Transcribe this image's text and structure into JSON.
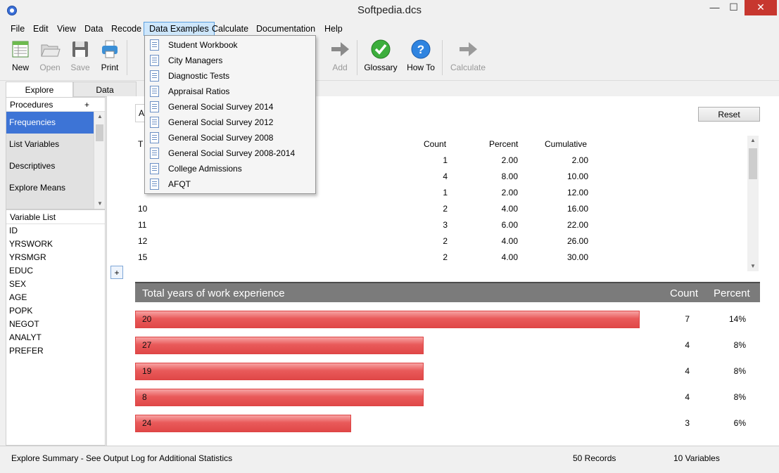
{
  "window": {
    "title": "Softpedia.dcs",
    "min_glyph": "—",
    "max_glyph": "☐",
    "close_glyph": "✕"
  },
  "menu": [
    "File",
    "Edit",
    "View",
    "Data",
    "Recode",
    "Data Examples",
    "Calculate",
    "Documentation",
    "Help"
  ],
  "toolbar": {
    "new": "New",
    "open": "Open",
    "save": "Save",
    "print": "Print",
    "add": "Add",
    "glossary": "Glossary",
    "howto": "How To",
    "calculate": "Calculate"
  },
  "tabs": [
    "Explore",
    "Data"
  ],
  "procedures": {
    "header": "Procedures",
    "plus": "+",
    "items": [
      "Frequencies",
      "List Variables",
      "Descriptives",
      "Explore Means"
    ]
  },
  "variables": {
    "header": "Variable List",
    "items": [
      "ID",
      "YRSWORK",
      "YRSMGR",
      "EDUC",
      "SEX",
      "AGE",
      "POPK",
      "NEGOT",
      "ANALYT",
      "PREFER"
    ]
  },
  "main": {
    "search_value": "A",
    "reset_label": "Reset",
    "plus_label": "+",
    "freq": {
      "title_letter": "T",
      "headers": {
        "count": "Count",
        "percent": "Percent",
        "cumulative": "Cumulative"
      },
      "rows": [
        {
          "value": "",
          "count": "1",
          "percent": "2.00",
          "cumulative": "2.00"
        },
        {
          "value": "",
          "count": "4",
          "percent": "8.00",
          "cumulative": "10.00"
        },
        {
          "value": "",
          "count": "1",
          "percent": "2.00",
          "cumulative": "12.00"
        },
        {
          "value": "10",
          "count": "2",
          "percent": "4.00",
          "cumulative": "16.00"
        },
        {
          "value": "11",
          "count": "3",
          "percent": "6.00",
          "cumulative": "22.00"
        },
        {
          "value": "12",
          "count": "2",
          "percent": "4.00",
          "cumulative": "26.00"
        },
        {
          "value": "15",
          "count": "2",
          "percent": "4.00",
          "cumulative": "30.00"
        }
      ]
    },
    "chart": {
      "title": "Total years of work experience",
      "count_header": "Count",
      "percent_header": "Percent",
      "rows": [
        {
          "label": "20",
          "count": "7",
          "percent": "14%"
        },
        {
          "label": "27",
          "count": "4",
          "percent": "8%"
        },
        {
          "label": "19",
          "count": "4",
          "percent": "8%"
        },
        {
          "label": "8",
          "count": "4",
          "percent": "8%"
        },
        {
          "label": "24",
          "count": "3",
          "percent": "6%"
        }
      ]
    }
  },
  "chart_data": {
    "type": "bar",
    "title": "Total years of work experience",
    "categories": [
      "20",
      "27",
      "19",
      "8",
      "24"
    ],
    "values": [
      7,
      4,
      4,
      4,
      3
    ],
    "percent_labels": [
      "14%",
      "8%",
      "8%",
      "8%",
      "6%"
    ],
    "orientation": "horizontal"
  },
  "dropdown": [
    "Student Workbook",
    "City Managers",
    "Diagnostic Tests",
    "Appraisal Ratios",
    "General Social Survey 2014",
    "General Social Survey 2012",
    "General Social Survey 2008",
    "General Social Survey 2008-2014",
    "College Admissions",
    "AFQT"
  ],
  "status": {
    "summary": "Explore Summary  -  See Output Log for Additional Statistics",
    "records": "50 Records",
    "variables": "10 Variables"
  },
  "colors": {
    "selection": "#3d74d6",
    "bar": "#e04848",
    "chart_header": "#7b7b7b"
  }
}
